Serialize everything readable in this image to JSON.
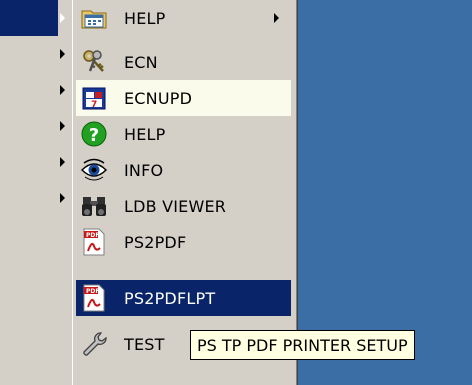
{
  "menu": {
    "items": [
      {
        "label": "HELP",
        "icon": "calendar-icon",
        "has_submenu": true,
        "state": "normal"
      },
      {
        "label": "ECN",
        "icon": "keys-icon",
        "has_submenu": false,
        "state": "normal"
      },
      {
        "label": "ECNUPD",
        "icon": "calendar-update-icon",
        "has_submenu": false,
        "state": "hover"
      },
      {
        "label": "HELP",
        "icon": "question-icon",
        "has_submenu": false,
        "state": "normal"
      },
      {
        "label": "INFO",
        "icon": "eye-icon",
        "has_submenu": false,
        "state": "normal"
      },
      {
        "label": "LDB VIEWER",
        "icon": "binoculars-icon",
        "has_submenu": false,
        "state": "normal"
      },
      {
        "label": "PS2PDF",
        "icon": "pdf-icon",
        "has_submenu": false,
        "state": "normal"
      },
      {
        "label": "PS2PDFLPT",
        "icon": "pdf-icon",
        "has_submenu": false,
        "state": "selected"
      },
      {
        "label": "TEST",
        "icon": "wrench-icon",
        "has_submenu": false,
        "state": "normal"
      }
    ]
  },
  "tooltip": {
    "text": "PS TP PDF PRINTER SETUP"
  },
  "colors": {
    "desktop": "#3a6ea5",
    "menu_bg": "#d4d0c8",
    "selected": "#0a246a",
    "hover": "#fbfbec",
    "tooltip_bg": "#ffffe1"
  }
}
